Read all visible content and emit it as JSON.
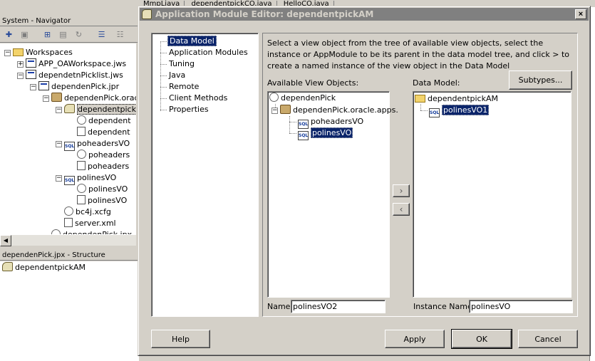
{
  "ide": {
    "tabs": [
      "MmpLjava",
      "dependentpickCO.java",
      "HelloCO.java"
    ],
    "navigator_title": "System - Navigator",
    "tree": [
      {
        "label": "Workspaces",
        "icon": "folder",
        "indent": 0,
        "toggle": "-"
      },
      {
        "label": "APP_OAWorkspace.jws",
        "icon": "proj",
        "indent": 1,
        "toggle": "+"
      },
      {
        "label": "dependetnPicklist.jws",
        "icon": "proj",
        "indent": 1,
        "toggle": "-"
      },
      {
        "label": "dependenPick.jpr",
        "icon": "proj",
        "indent": 2,
        "toggle": "-"
      },
      {
        "label": "dependenPick.oracle",
        "icon": "pkg",
        "indent": 3,
        "toggle": "-"
      },
      {
        "label": "dependentpick",
        "icon": "comp",
        "indent": 4,
        "toggle": "-",
        "selected": true
      },
      {
        "label": "dependent",
        "icon": "gear",
        "indent": 5
      },
      {
        "label": "dependent",
        "icon": "file",
        "indent": 5
      },
      {
        "label": "poheadersVO",
        "icon": "sql",
        "indent": 4,
        "toggle": "-"
      },
      {
        "label": "poheaders",
        "icon": "gear",
        "indent": 5
      },
      {
        "label": "poheaders",
        "icon": "file",
        "indent": 5
      },
      {
        "label": "polinesVO",
        "icon": "sql",
        "indent": 4,
        "toggle": "-"
      },
      {
        "label": "polinesVO",
        "icon": "gear",
        "indent": 5
      },
      {
        "label": "polinesVO",
        "icon": "file",
        "indent": 5
      },
      {
        "label": "bc4j.xcfg",
        "icon": "gear",
        "indent": 4
      },
      {
        "label": "server.xml",
        "icon": "file",
        "indent": 4
      },
      {
        "label": "dependenPick.jpx",
        "icon": "gear",
        "indent": 3
      }
    ],
    "structure_title": "dependenPick.jpx - Structure",
    "structure_item": "dependentpickAM"
  },
  "dialog": {
    "title": "Application Module Editor: dependentpickAM",
    "close_label": "×",
    "nav_items": [
      "Data Model",
      "Application Modules",
      "Tuning",
      "Java",
      "Remote",
      "Client Methods",
      "Properties"
    ],
    "active_nav": "Data Model",
    "description": "Select a view object from the tree of available view objects, select the instance or AppModule to be its parent in the data model tree, and click > to create a named instance of the view object in the Data Model",
    "available_label": "Available View Objects:",
    "data_model_label": "Data Model:",
    "subtypes_label": "Subtypes...",
    "available_tree": {
      "root": "dependenPick",
      "package": "dependenPick.oracle.apps.",
      "items": [
        "poheadersVO",
        "polinesVO"
      ],
      "selected": "polinesVO"
    },
    "data_model_tree": {
      "root": "dependentpickAM",
      "items": [
        "polinesVO1"
      ],
      "selected": "polinesVO1"
    },
    "add_arrow": "›",
    "remove_arrow": "‹",
    "name_label": "Name:",
    "name_value": "polinesVO2",
    "instance_name_label": "Instance Name:",
    "instance_name_value": "polinesVO",
    "buttons": {
      "help": "Help",
      "apply": "Apply",
      "ok": "OK",
      "cancel": "Cancel"
    }
  }
}
